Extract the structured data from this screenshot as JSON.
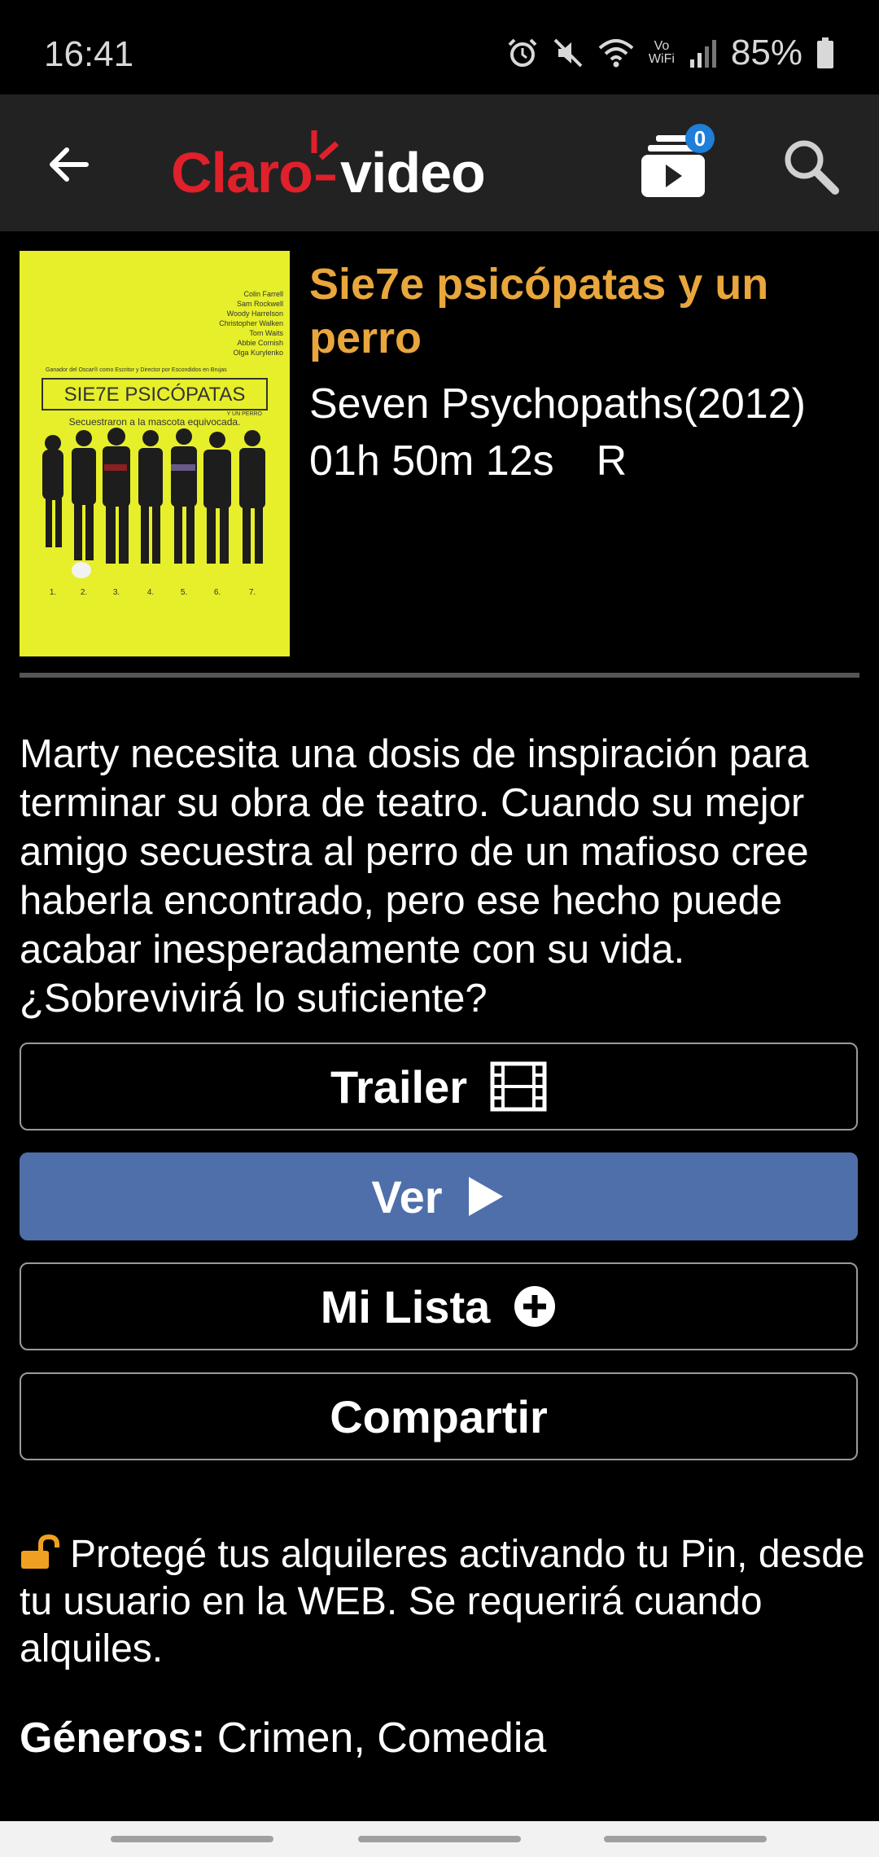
{
  "status_bar": {
    "time": "16:41",
    "wifi_label": "Vo WiFi",
    "battery": "85%",
    "icons": [
      "alarm-icon",
      "mute-icon",
      "wifi-icon",
      "vowifi-icon",
      "signal-icon",
      "battery-icon"
    ]
  },
  "header": {
    "logo_part1": "Claro",
    "logo_part2": "video",
    "rentals_count": "0",
    "icons": [
      "back-arrow-icon",
      "rentals-play-icon",
      "search-icon"
    ],
    "accent_color": "#e0202a"
  },
  "movie": {
    "title": "Sie7e psicópatas y un perro",
    "original_title": "Seven Psychopaths(2012)",
    "duration": "01h 50m 12s",
    "rating": "R",
    "synopsis": "Marty necesita una dosis de inspiración para terminar su obra de teatro. Cuando su mejor amigo secuestra al perro de un mafioso cree haberla encontrado, pero ese hecho puede acabar inesperadamente con su vida. ¿Sobrevivirá lo suficiente?",
    "title_color": "#e8a63c",
    "poster": {
      "cast": [
        "Colin Farrell",
        "Sam Rockwell",
        "Woody Harrelson",
        "Christopher Walken",
        "Tom Waits",
        "Abbie Cornish",
        "Olga Kurylenko"
      ],
      "award_line": "Ganador del Oscar® como Escritor y Director por Escondidos en Brujas",
      "poster_title": "SIE7E PSICÓPATAS",
      "poster_subtitle": "Y UN PERRO",
      "tagline": "Secuestraron a la mascota equivocada.",
      "numbers": [
        "1.",
        "2.",
        "3.",
        "4.",
        "5.",
        "6.",
        "7."
      ],
      "background_color": "#e6ef2a"
    }
  },
  "actions": {
    "trailer": "Trailer",
    "ver": "Ver",
    "mi_lista": "Mi Lista",
    "compartir": "Compartir",
    "ver_color": "#4e6fa9"
  },
  "pin_notice": "Protegé tus alquileres activando tu Pin, desde tu usuario en la WEB. Se requerirá cuando alquiles.",
  "genres": {
    "label": "Géneros:",
    "value": "Crimen, Comedia"
  }
}
